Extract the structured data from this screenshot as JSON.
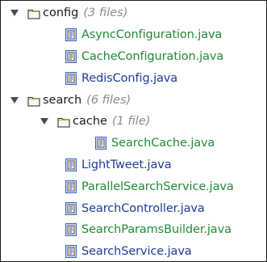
{
  "tree": {
    "config": {
      "name": "config",
      "count": "(3 files)",
      "files": [
        {
          "name": "AsyncConfiguration.java",
          "color": "#218a35"
        },
        {
          "name": "CacheConfiguration.java",
          "color": "#218a35"
        },
        {
          "name": "RedisConfig.java",
          "color": "#1f3a99"
        }
      ]
    },
    "search": {
      "name": "search",
      "count": "(6 files)",
      "cache": {
        "name": "cache",
        "count": "(1 file)",
        "files": [
          {
            "name": "SearchCache.java",
            "color": "#218a35"
          }
        ]
      },
      "files": [
        {
          "name": "LightTweet.java",
          "color": "#1f3a99"
        },
        {
          "name": "ParallelSearchService.java",
          "color": "#218a35"
        },
        {
          "name": "SearchController.java",
          "color": "#1f3a99"
        },
        {
          "name": "SearchParamsBuilder.java",
          "color": "#218a35"
        },
        {
          "name": "SearchService.java",
          "color": "#1f3a99"
        }
      ]
    }
  },
  "icons": {
    "folder": "folder-icon",
    "file": "java-file-icon",
    "expanded": "triangle-down-icon"
  },
  "colors": {
    "folder_accent": "#c9a74e",
    "file_icon_blue": "#3a63c9"
  }
}
